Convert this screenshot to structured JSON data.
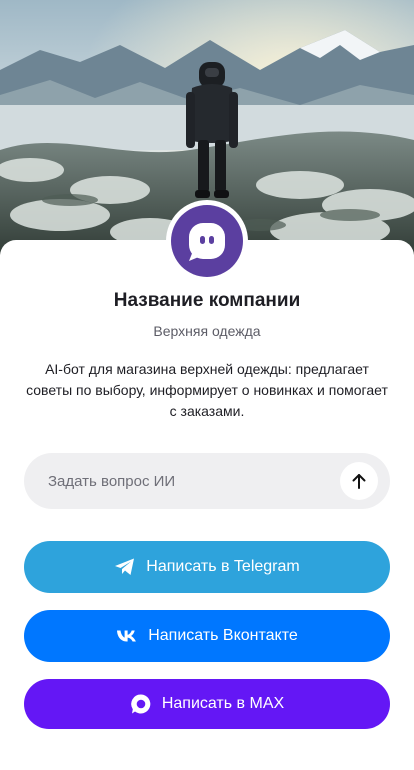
{
  "profile": {
    "company_name": "Название компании",
    "category": "Верхняя одежда",
    "description": "AI-бот для магазина верхней одежды: предлагает советы по выбору, информирует о новинках и помогает с заказами."
  },
  "ask": {
    "placeholder": "Задать вопрос ИИ",
    "value": ""
  },
  "actions": {
    "telegram_label": "Написать в Telegram",
    "vk_label": "Написать Вконтакте",
    "max_label": "Написать в MAX"
  },
  "icons": {
    "avatar": "chat-bubble-icon",
    "send": "arrow-up-icon",
    "telegram": "telegram-icon",
    "vk": "vk-icon",
    "max": "max-icon"
  },
  "colors": {
    "avatar_bg": "#5b3fa0",
    "telegram": "#2ea3dc",
    "vk": "#0077ff",
    "max": "#6417f5",
    "input_bg": "#efeff1"
  }
}
